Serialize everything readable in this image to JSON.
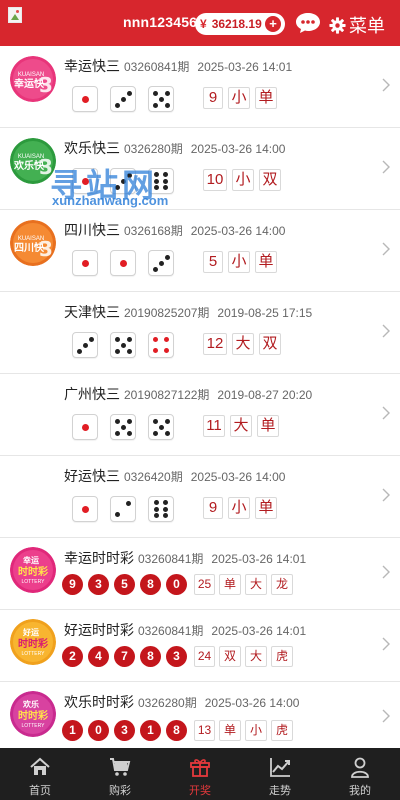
{
  "header": {
    "username": "nnn123456",
    "currency_symbol": "¥",
    "balance": "36218.19",
    "menu_label": "菜单",
    "accent_color": "#d7262d"
  },
  "watermark": {
    "title": "寻站网",
    "url": "xunzhanwang.com"
  },
  "k3_games": [
    {
      "name": "幸运快三",
      "issue": "03260841期",
      "time": "2025-03-26 14:01",
      "dice": [
        1,
        3,
        5
      ],
      "sum": "9",
      "size": "小",
      "parity": "单"
    },
    {
      "name": "欢乐快三",
      "issue": "0326280期",
      "time": "2025-03-26 14:00",
      "dice": [
        1,
        3,
        6
      ],
      "sum": "10",
      "size": "小",
      "parity": "双"
    },
    {
      "name": "四川快三",
      "issue": "0326168期",
      "time": "2025-03-26 14:00",
      "dice": [
        1,
        1,
        3
      ],
      "sum": "5",
      "size": "小",
      "parity": "单"
    },
    {
      "name": "天津快三",
      "issue": "20190825207期",
      "time": "2019-08-25 17:15",
      "dice": [
        3,
        5,
        4
      ],
      "sum": "12",
      "size": "大",
      "parity": "双"
    },
    {
      "name": "广州快三",
      "issue": "20190827122期",
      "time": "2019-08-27 20:20",
      "dice": [
        1,
        5,
        5
      ],
      "sum": "11",
      "size": "大",
      "parity": "单"
    },
    {
      "name": "好运快三",
      "issue": "0326420期",
      "time": "2025-03-26 14:00",
      "dice": [
        1,
        2,
        6
      ],
      "sum": "9",
      "size": "小",
      "parity": "单"
    }
  ],
  "ssc_games": [
    {
      "name": "幸运时时彩",
      "issue": "03260841期",
      "time": "2025-03-26 14:01",
      "balls": [
        "9",
        "3",
        "5",
        "8",
        "0"
      ],
      "sum": "25",
      "parity": "单",
      "size": "大",
      "dragon": "龙"
    },
    {
      "name": "好运时时彩",
      "issue": "03260841期",
      "time": "2025-03-26 14:01",
      "balls": [
        "2",
        "4",
        "7",
        "8",
        "3"
      ],
      "sum": "24",
      "parity": "双",
      "size": "大",
      "dragon": "虎"
    },
    {
      "name": "欢乐时时彩",
      "issue": "0326280期",
      "time": "2025-03-26 14:00",
      "balls": [
        "1",
        "0",
        "3",
        "1",
        "8"
      ],
      "sum": "13",
      "parity": "单",
      "size": "小",
      "dragon": "虎"
    }
  ],
  "logos": {
    "k3_brand": "KUAISAN",
    "k3_1": "幸运快",
    "k3_2": "欢乐快",
    "k3_3": "四川快",
    "ssc_1_top": "幸运",
    "ssc_1_main": "时时彩",
    "ssc_2_top": "好运",
    "ssc_2_main": "时时彩",
    "ssc_3_top": "欢乐",
    "ssc_3_main": "时时彩",
    "ssc_sub": "LOTTERY"
  },
  "nav": [
    {
      "label": "首页",
      "icon": "home-icon"
    },
    {
      "label": "购彩",
      "icon": "cart-icon"
    },
    {
      "label": "开奖",
      "icon": "gift-icon",
      "active": true
    },
    {
      "label": "走势",
      "icon": "trend-icon"
    },
    {
      "label": "我的",
      "icon": "user-icon"
    }
  ]
}
